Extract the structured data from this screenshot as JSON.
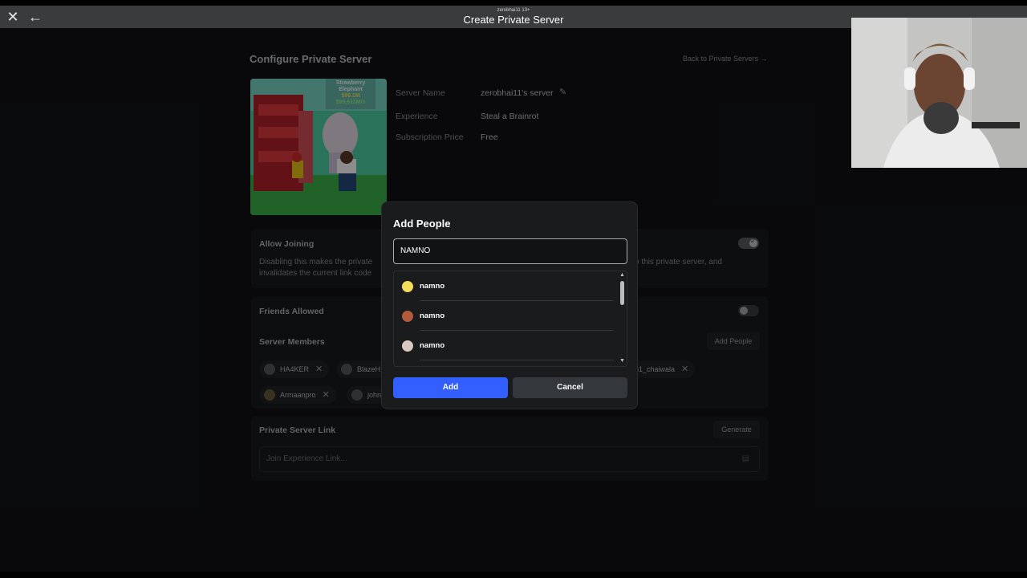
{
  "titlebar": {
    "user": "zerobhai11 13+",
    "title": "Create Private Server",
    "close_icon": "close-icon",
    "back_icon": "back-arrow-icon"
  },
  "page": {
    "heading": "Configure Private Server",
    "back_link": "Back to Private Servers →",
    "thumbnail_text": [
      "Strawberry",
      "Elephant",
      "$99.1M",
      "$99,611M/s"
    ]
  },
  "info": {
    "server_name_label": "Server Name",
    "server_name_value": "zerobhai11's server",
    "experience_label": "Experience",
    "experience_value": "Steal a Brainrot",
    "price_label": "Subscription Price",
    "price_value": "Free"
  },
  "allow_joining": {
    "title": "Allow Joining",
    "desc_left_1": "Disabling this makes the private",
    "desc_left_2": "invalidates the current link code",
    "desc_right": "o this private server, and",
    "enabled": true
  },
  "friends_allowed": {
    "title": "Friends Allowed",
    "enabled": false
  },
  "server_members": {
    "title": "Server Members",
    "add_people_button": "Add People",
    "members": [
      "HA4KER",
      "BlazeH",
      "o1_chaiwala",
      "Armaanpro",
      "john"
    ]
  },
  "private_link": {
    "title": "Private Server Link",
    "generate_button": "Generate",
    "placeholder": "Join Experience Link..."
  },
  "modal": {
    "title": "Add People",
    "search_value": "NAMNO",
    "results": [
      "namno",
      "namno",
      "namno"
    ],
    "add_button": "Add",
    "cancel_button": "Cancel"
  },
  "colors": {
    "primary": "#335fff",
    "background": "#111214",
    "titlebar": "#393b3d"
  }
}
